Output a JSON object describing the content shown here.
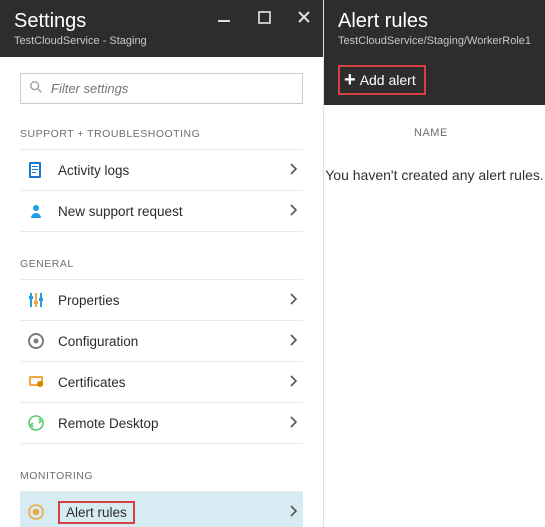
{
  "left": {
    "title": "Settings",
    "subtitle": "TestCloudService - Staging",
    "search_placeholder": "Filter settings",
    "sections": {
      "support": {
        "title": "SUPPORT + TROUBLESHOOTING",
        "items": [
          {
            "label": "Activity logs"
          },
          {
            "label": "New support request"
          }
        ]
      },
      "general": {
        "title": "GENERAL",
        "items": [
          {
            "label": "Properties"
          },
          {
            "label": "Configuration"
          },
          {
            "label": "Certificates"
          },
          {
            "label": "Remote Desktop"
          }
        ]
      },
      "monitoring": {
        "title": "MONITORING",
        "items": [
          {
            "label": "Alert rules"
          }
        ]
      }
    }
  },
  "right": {
    "title": "Alert rules",
    "subtitle": "TestCloudService/Staging/WorkerRole1",
    "add_button": "Add alert",
    "column_header": "NAME",
    "empty_text": "You haven't created any alert rules."
  }
}
